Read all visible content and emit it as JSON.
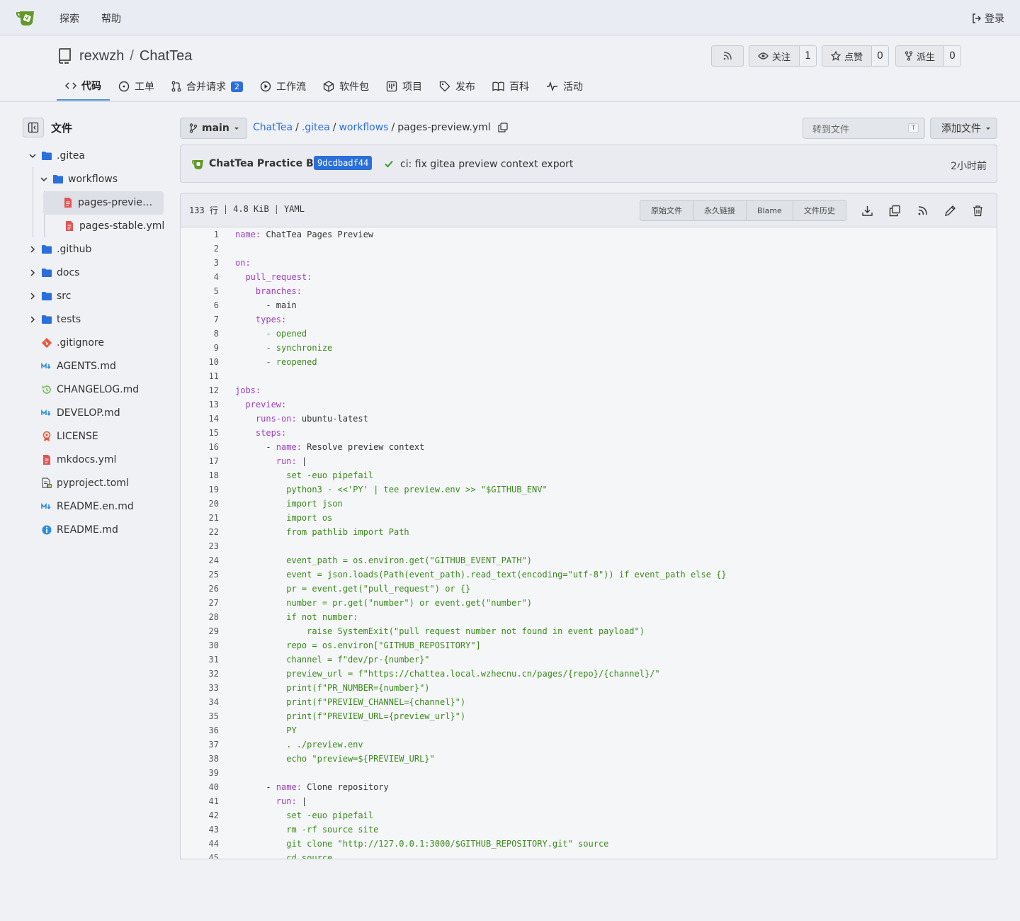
{
  "navbar": {
    "explore": "探索",
    "help": "帮助",
    "login": "登录"
  },
  "repo": {
    "owner": "rexwzh",
    "separator": "/",
    "name": "ChatTea",
    "watch_label": "关注",
    "watch_count": "1",
    "star_label": "点赞",
    "star_count": "0",
    "fork_label": "派生",
    "fork_count": "0"
  },
  "tabs": [
    {
      "label": "代码",
      "icon": "code-icon"
    },
    {
      "label": "工单",
      "icon": "issue-icon"
    },
    {
      "label": "合并请求",
      "icon": "pull-request-icon",
      "badge": "2"
    },
    {
      "label": "工作流",
      "icon": "play-icon"
    },
    {
      "label": "软件包",
      "icon": "package-icon"
    },
    {
      "label": "项目",
      "icon": "project-icon"
    },
    {
      "label": "发布",
      "icon": "tag-icon"
    },
    {
      "label": "百科",
      "icon": "book-icon"
    },
    {
      "label": "活动",
      "icon": "pulse-icon"
    }
  ],
  "sidebar": {
    "title": "文件",
    "tree": [
      {
        "name": ".gitea",
        "type": "folder",
        "open": true
      },
      {
        "name": "workflows",
        "type": "folder",
        "open": true
      },
      {
        "name": "pages-preview.yml",
        "display": "pages-preview.…",
        "type": "yml",
        "selected": true
      },
      {
        "name": "pages-stable.yml",
        "type": "yml"
      },
      {
        "name": ".github",
        "type": "folder"
      },
      {
        "name": "docs",
        "type": "folder"
      },
      {
        "name": "src",
        "type": "folder"
      },
      {
        "name": "tests",
        "type": "folder"
      },
      {
        "name": ".gitignore",
        "type": "git"
      },
      {
        "name": "AGENTS.md",
        "type": "md"
      },
      {
        "name": "CHANGELOG.md",
        "type": "changelog"
      },
      {
        "name": "DEVELOP.md",
        "type": "md"
      },
      {
        "name": "LICENSE",
        "type": "license"
      },
      {
        "name": "mkdocs.yml",
        "type": "yml"
      },
      {
        "name": "pyproject.toml",
        "type": "toml"
      },
      {
        "name": "README.en.md",
        "type": "md"
      },
      {
        "name": "README.md",
        "type": "info"
      }
    ]
  },
  "branch": "main",
  "breadcrumb": {
    "parts": [
      "ChatTea",
      ".gitea",
      "workflows"
    ],
    "file": "pages-preview.yml",
    "sep": "/"
  },
  "goto_file": "转到文件",
  "goto_kbd": "T",
  "add_file": "添加文件",
  "commit": {
    "author": "ChatTea Practice Bot",
    "sha": "9dcdbadf44",
    "message": "ci: fix gitea preview context export",
    "time": "2小时前"
  },
  "file": {
    "lines": "133 行",
    "size": "4.8 KiB",
    "lang": "YAML",
    "buttons": [
      "原始文件",
      "永久链接",
      "Blame",
      "文件历史"
    ]
  },
  "code": [
    [
      {
        "t": "k",
        "v": "name:"
      },
      {
        "t": "p",
        "v": " ChatTea Pages Preview"
      }
    ],
    [],
    [
      {
        "t": "k",
        "v": "on:"
      }
    ],
    [
      {
        "t": "k",
        "v": "  pull_request:"
      }
    ],
    [
      {
        "t": "k",
        "v": "    branches:"
      }
    ],
    [
      {
        "t": "p",
        "v": "      - main"
      }
    ],
    [
      {
        "t": "k",
        "v": "    types:"
      }
    ],
    [
      {
        "t": "s",
        "v": "      - opened"
      }
    ],
    [
      {
        "t": "s",
        "v": "      - synchronize"
      }
    ],
    [
      {
        "t": "s",
        "v": "      - reopened"
      }
    ],
    [],
    [
      {
        "t": "k",
        "v": "jobs:"
      }
    ],
    [
      {
        "t": "k",
        "v": "  preview:"
      }
    ],
    [
      {
        "t": "k",
        "v": "    runs-on:"
      },
      {
        "t": "p",
        "v": " ubuntu-latest"
      }
    ],
    [
      {
        "t": "k",
        "v": "    steps:"
      }
    ],
    [
      {
        "t": "p",
        "v": "      - "
      },
      {
        "t": "k",
        "v": "name:"
      },
      {
        "t": "p",
        "v": " Resolve preview context"
      }
    ],
    [
      {
        "t": "k",
        "v": "        run:"
      },
      {
        "t": "p",
        "v": " |"
      }
    ],
    [
      {
        "t": "s",
        "v": "          set -euo pipefail"
      }
    ],
    [
      {
        "t": "s",
        "v": "          python3 - <<'PY' | tee preview.env >> \"$GITHUB_ENV\""
      }
    ],
    [
      {
        "t": "s",
        "v": "          import json"
      }
    ],
    [
      {
        "t": "s",
        "v": "          import os"
      }
    ],
    [
      {
        "t": "s",
        "v": "          from pathlib import Path"
      }
    ],
    [],
    [
      {
        "t": "s",
        "v": "          event_path = os.environ.get(\"GITHUB_EVENT_PATH\")"
      }
    ],
    [
      {
        "t": "s",
        "v": "          event = json.loads(Path(event_path).read_text(encoding=\"utf-8\")) if event_path else {}"
      }
    ],
    [
      {
        "t": "s",
        "v": "          pr = event.get(\"pull_request\") or {}"
      }
    ],
    [
      {
        "t": "s",
        "v": "          number = pr.get(\"number\") or event.get(\"number\")"
      }
    ],
    [
      {
        "t": "s",
        "v": "          if not number:"
      }
    ],
    [
      {
        "t": "s",
        "v": "              raise SystemExit(\"pull request number not found in event payload\")"
      }
    ],
    [
      {
        "t": "s",
        "v": "          repo = os.environ[\"GITHUB_REPOSITORY\"]"
      }
    ],
    [
      {
        "t": "s",
        "v": "          channel = f\"dev/pr-{number}\""
      }
    ],
    [
      {
        "t": "s",
        "v": "          preview_url = f\"https://chattea.local.wzhecnu.cn/pages/{repo}/{channel}/\""
      }
    ],
    [
      {
        "t": "s",
        "v": "          print(f\"PR_NUMBER={number}\")"
      }
    ],
    [
      {
        "t": "s",
        "v": "          print(f\"PREVIEW_CHANNEL={channel}\")"
      }
    ],
    [
      {
        "t": "s",
        "v": "          print(f\"PREVIEW_URL={preview_url}\")"
      }
    ],
    [
      {
        "t": "s",
        "v": "          PY"
      }
    ],
    [
      {
        "t": "s",
        "v": "          . ./preview.env"
      }
    ],
    [
      {
        "t": "s",
        "v": "          echo \"preview=${PREVIEW_URL}\""
      }
    ],
    [],
    [
      {
        "t": "p",
        "v": "      - "
      },
      {
        "t": "k",
        "v": "name:"
      },
      {
        "t": "p",
        "v": " Clone repository"
      }
    ],
    [
      {
        "t": "k",
        "v": "        run:"
      },
      {
        "t": "p",
        "v": " |"
      }
    ],
    [
      {
        "t": "s",
        "v": "          set -euo pipefail"
      }
    ],
    [
      {
        "t": "s",
        "v": "          rm -rf source site"
      }
    ],
    [
      {
        "t": "s",
        "v": "          git clone \"http://127.0.0.1:3000/$GITHUB_REPOSITORY.git\" source"
      }
    ],
    [
      {
        "t": "s",
        "v": "          cd source"
      }
    ]
  ],
  "colors": {
    "accent": "#2a6fdb",
    "folder": "#2a6fdb",
    "yaml_key": "#9c3fbf",
    "yaml_string": "#3a8a1b",
    "logo_green": "#609926"
  }
}
